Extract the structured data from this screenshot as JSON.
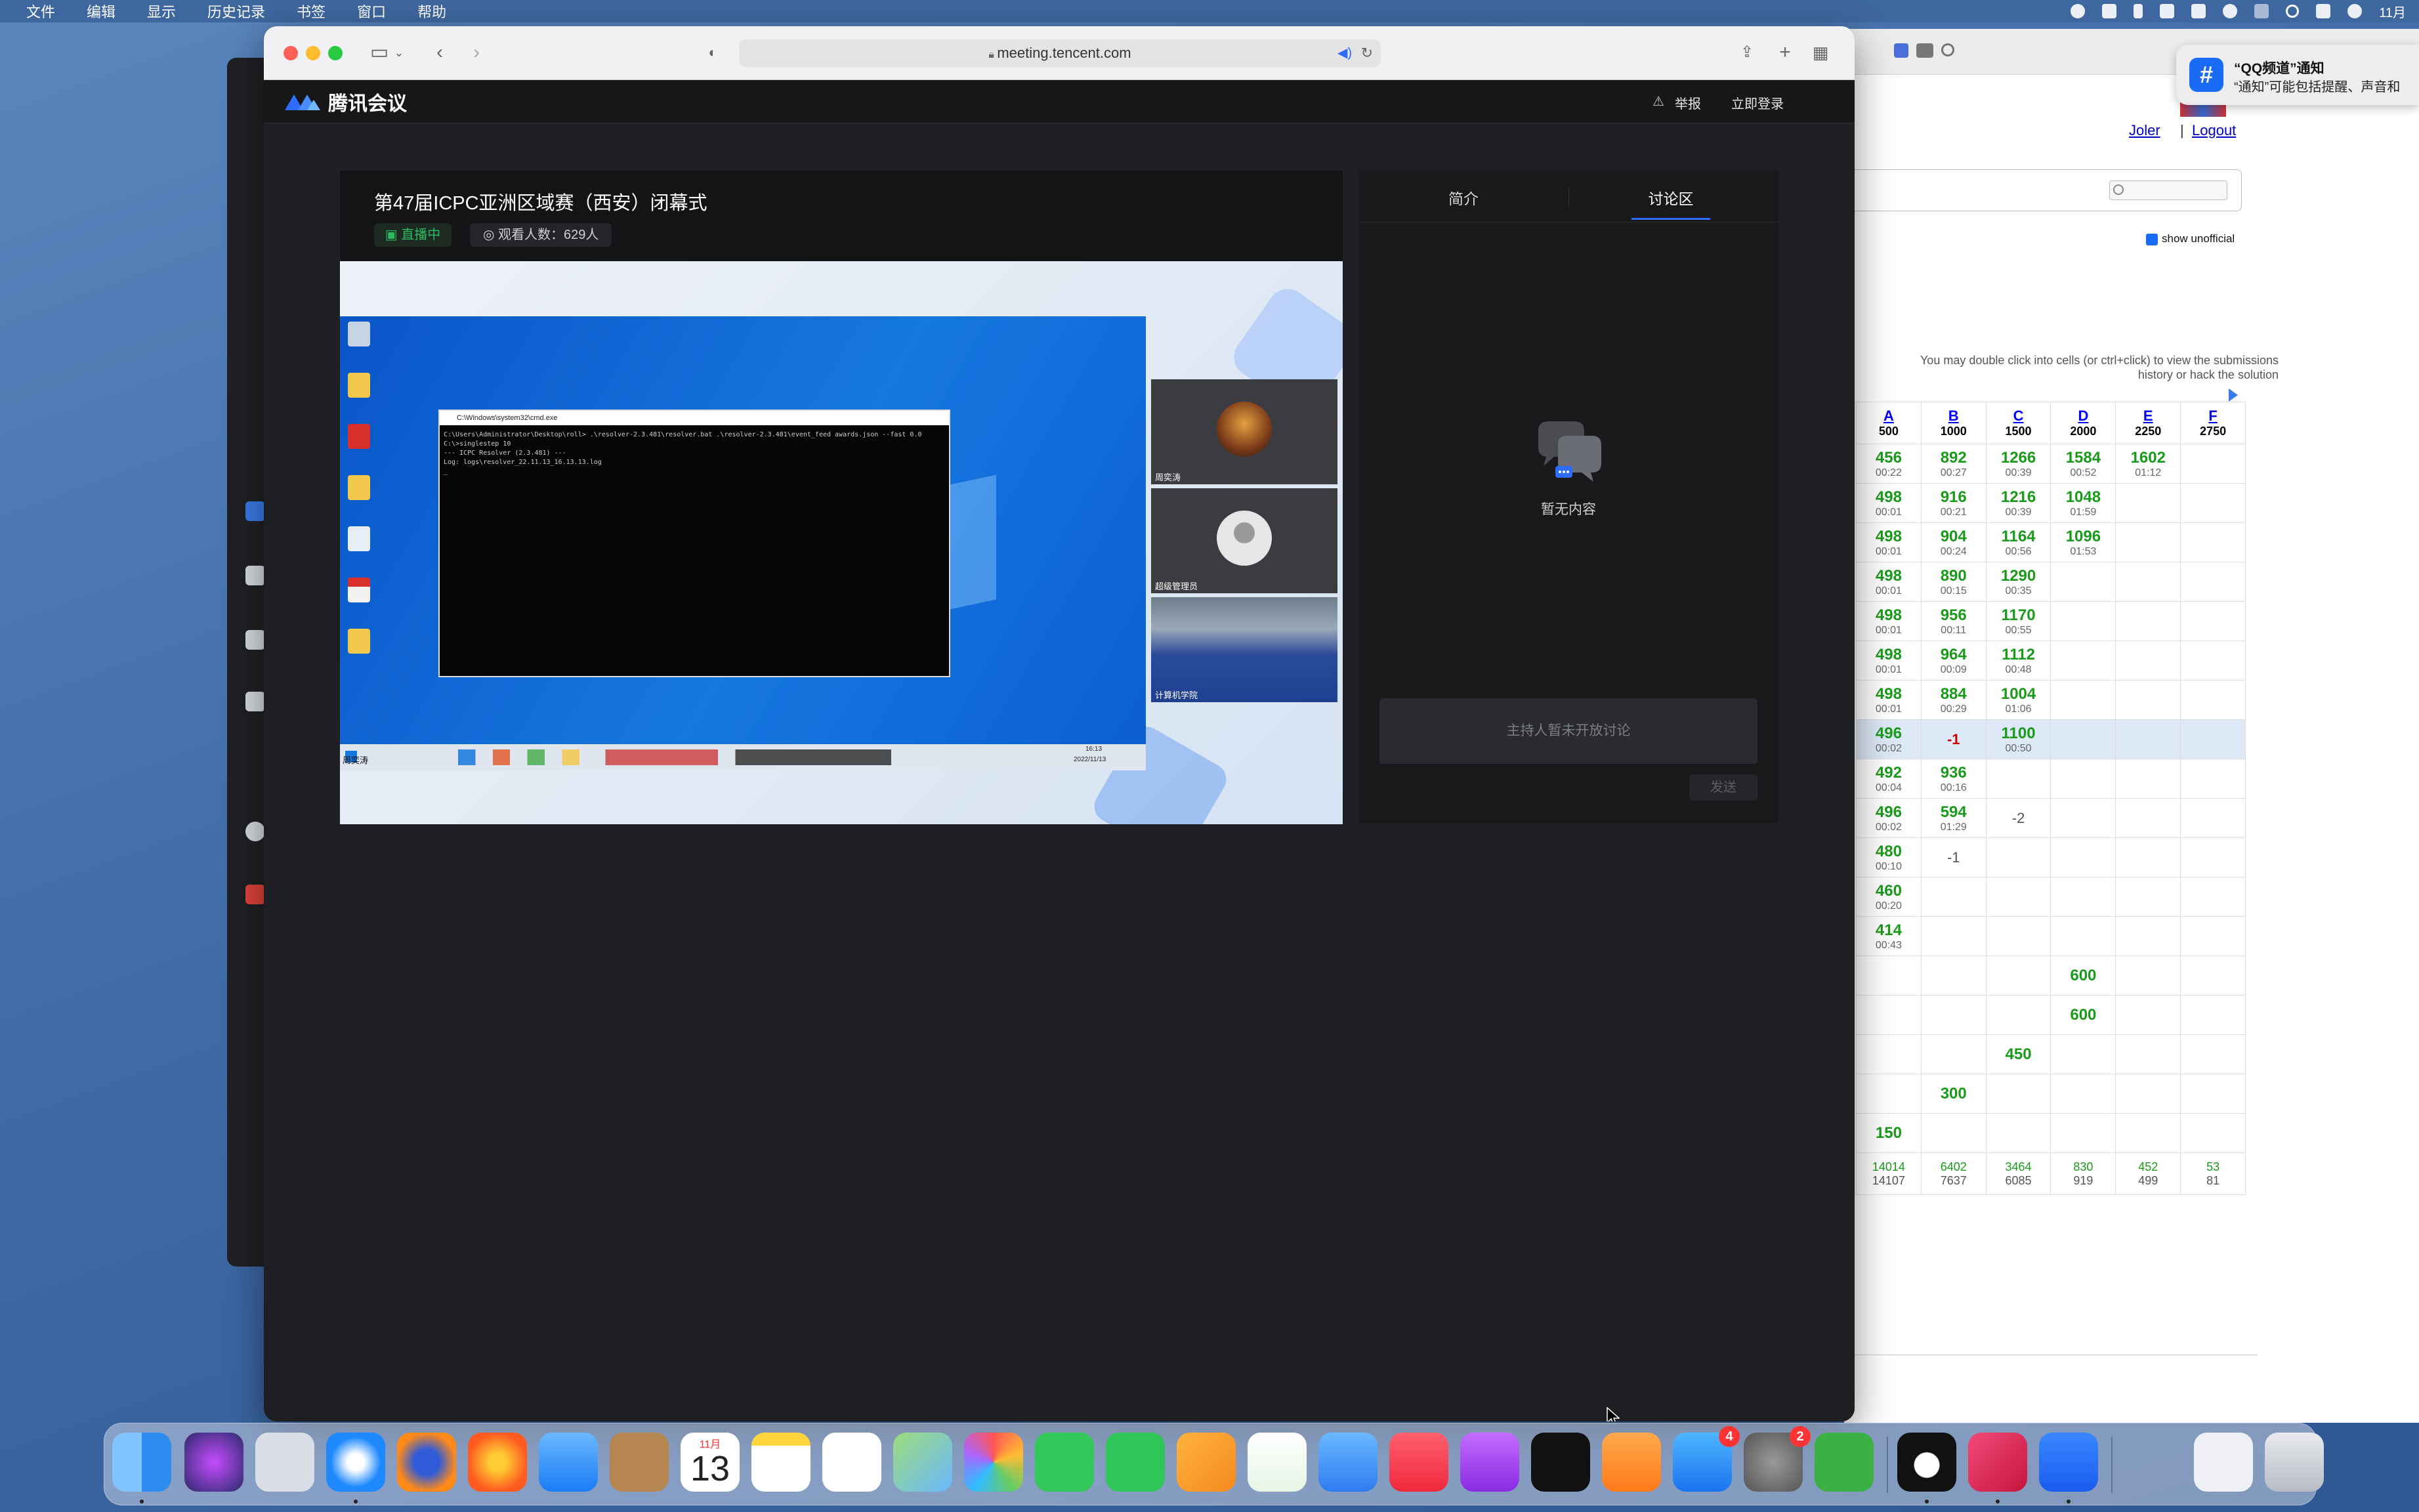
{
  "menubar": {
    "items": [
      "文件",
      "编辑",
      "显示",
      "历史记录",
      "书签",
      "窗口",
      "帮助"
    ],
    "clock": "11月"
  },
  "browser": {
    "url": "meeting.tencent.com"
  },
  "tencent": {
    "logo_text": "腾讯会议",
    "report_label": "举报",
    "login_label": "立即登录"
  },
  "video": {
    "title": "第47届ICPC亚洲区域赛（西安）闭幕式",
    "live_label": "直播中",
    "viewers_label": "观看人数：629人",
    "cmd_title": "C:\\Windows\\system32\\cmd.exe",
    "cmd_lines": "C:\\Users\\Administrator\\Desktop\\roll> .\\resolver-2.3.481\\resolver.bat .\\resolver-2.3.481\\event_feed awards.json --fast 0.0\nC:\\>singlestep 10\n--- ICPC Resolver (2.3.481) ---\nLog: logs\\resolver_22.11.13_16.13.13.log\n_",
    "taskbar_time": "16:13",
    "taskbar_date": "2022/11/13",
    "participants": [
      {
        "name": "周奕涛"
      },
      {
        "name": "超级管理员"
      },
      {
        "name": "计算机学院"
      }
    ],
    "presenter_label": "周奕涛"
  },
  "sidebar": {
    "tabs": [
      "简介",
      "讨论区"
    ],
    "active_tab": "讨论区",
    "empty_text": "暂无内容",
    "discussion_placeholder": "主持人暂未开放讨论",
    "send_label": "发送"
  },
  "notification": {
    "title": "“QQ频道”通知",
    "body": "“通知”可能包括提醒、声音和"
  },
  "scoreboard": {
    "user_link": "Joler",
    "logout_link": "Logout",
    "show_unofficial": "show unofficial",
    "hint": "You may double click into cells (or ctrl+click) to view the submissions history or hack the solution",
    "columns": [
      {
        "letter": "A",
        "points": "500"
      },
      {
        "letter": "B",
        "points": "1000"
      },
      {
        "letter": "C",
        "points": "1500"
      },
      {
        "letter": "D",
        "points": "2000"
      },
      {
        "letter": "E",
        "points": "2250"
      },
      {
        "letter": "F",
        "points": "2750"
      }
    ],
    "rows": [
      [
        [
          "456",
          "00:22"
        ],
        [
          "892",
          "00:27"
        ],
        [
          "1266",
          "00:39"
        ],
        [
          "1584",
          "00:52"
        ],
        [
          "1602",
          "01:12"
        ],
        [
          "",
          ""
        ]
      ],
      [
        [
          "498",
          "00:01"
        ],
        [
          "916",
          "00:21"
        ],
        [
          "1216",
          "00:39"
        ],
        [
          "1048",
          "01:59"
        ],
        [
          "",
          ""
        ],
        [
          "",
          ""
        ]
      ],
      [
        [
          "498",
          "00:01"
        ],
        [
          "904",
          "00:24"
        ],
        [
          "1164",
          "00:56"
        ],
        [
          "1096",
          "01:53"
        ],
        [
          "",
          ""
        ],
        [
          "",
          ""
        ]
      ],
      [
        [
          "498",
          "00:01"
        ],
        [
          "890",
          "00:15"
        ],
        [
          "1290",
          "00:35"
        ],
        [
          "",
          ""
        ],
        [
          "",
          ""
        ],
        [
          "",
          ""
        ]
      ],
      [
        [
          "498",
          "00:01"
        ],
        [
          "956",
          "00:11"
        ],
        [
          "1170",
          "00:55"
        ],
        [
          "",
          ""
        ],
        [
          "",
          ""
        ],
        [
          "",
          ""
        ]
      ],
      [
        [
          "498",
          "00:01"
        ],
        [
          "964",
          "00:09"
        ],
        [
          "1112",
          "00:48"
        ],
        [
          "",
          ""
        ],
        [
          "",
          ""
        ],
        [
          "",
          ""
        ]
      ],
      [
        [
          "498",
          "00:01"
        ],
        [
          "884",
          "00:29"
        ],
        [
          "1004",
          "01:06"
        ],
        [
          "",
          ""
        ],
        [
          "",
          ""
        ],
        [
          "",
          ""
        ]
      ],
      [
        [
          "496",
          "00:02"
        ],
        [
          "-1",
          ""
        ],
        [
          "1100",
          "00:50"
        ],
        [
          "",
          ""
        ],
        [
          "",
          ""
        ],
        [
          "",
          ""
        ]
      ],
      [
        [
          "492",
          "00:04"
        ],
        [
          "936",
          "00:16"
        ],
        [
          "",
          ""
        ],
        [
          "",
          ""
        ],
        [
          "",
          ""
        ],
        [
          "",
          ""
        ]
      ],
      [
        [
          "496",
          "00:02"
        ],
        [
          "594",
          "01:29"
        ],
        [
          "-2",
          ""
        ],
        [
          "",
          ""
        ],
        [
          "",
          ""
        ],
        [
          "",
          ""
        ]
      ],
      [
        [
          "480",
          "00:10"
        ],
        [
          "-1",
          ""
        ],
        [
          "",
          ""
        ],
        [
          "",
          ""
        ],
        [
          "",
          ""
        ],
        [
          "",
          ""
        ]
      ],
      [
        [
          "460",
          "00:20"
        ],
        [
          "",
          ""
        ],
        [
          "",
          ""
        ],
        [
          "",
          ""
        ],
        [
          "",
          ""
        ],
        [
          "",
          ""
        ]
      ],
      [
        [
          "414",
          "00:43"
        ],
        [
          "",
          ""
        ],
        [
          "",
          ""
        ],
        [
          "",
          ""
        ],
        [
          "",
          ""
        ],
        [
          "",
          ""
        ]
      ],
      [
        [
          "",
          ""
        ],
        [
          "",
          ""
        ],
        [
          "",
          ""
        ],
        [
          "600",
          ""
        ],
        [
          "",
          ""
        ],
        [
          "",
          ""
        ]
      ],
      [
        [
          "",
          ""
        ],
        [
          "",
          ""
        ],
        [
          "",
          ""
        ],
        [
          "600",
          ""
        ],
        [
          "",
          ""
        ],
        [
          "",
          ""
        ]
      ],
      [
        [
          "",
          ""
        ],
        [
          "",
          ""
        ],
        [
          "450",
          ""
        ],
        [
          "",
          ""
        ],
        [
          "",
          ""
        ],
        [
          "",
          ""
        ]
      ],
      [
        [
          "",
          ""
        ],
        [
          "300",
          ""
        ],
        [
          "",
          ""
        ],
        [
          "",
          ""
        ],
        [
          "",
          ""
        ],
        [
          "",
          ""
        ]
      ],
      [
        [
          "150",
          ""
        ],
        [
          "",
          ""
        ],
        [
          "",
          ""
        ],
        [
          "",
          ""
        ],
        [
          "",
          ""
        ],
        [
          "",
          ""
        ]
      ]
    ],
    "totals": [
      [
        "14014",
        "14107"
      ],
      [
        "6402",
        "7637"
      ],
      [
        "3464",
        "6085"
      ],
      [
        "830",
        "919"
      ],
      [
        "452",
        "499"
      ],
      [
        "53",
        "81"
      ]
    ]
  },
  "dock": {
    "calendar_month": "11月",
    "calendar_day": "13",
    "appstore_badge": "4",
    "settings_badge": "2"
  },
  "colors": {
    "accent": "#2e6bff",
    "live_green": "#2bbb60",
    "accepted_green": "#1a9a1a"
  }
}
